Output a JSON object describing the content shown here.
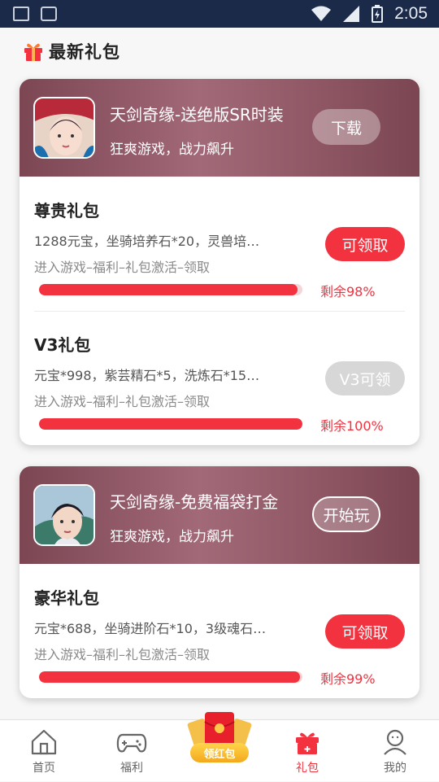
{
  "status_bar": {
    "time": "2:05"
  },
  "page": {
    "title": "最新礼包"
  },
  "cards": [
    {
      "game_title": "天剑奇缘-送绝版SR时装",
      "game_subtitle": "狂爽游戏，战力飙升",
      "head_button": "下载",
      "packs": [
        {
          "name": "尊贵礼包",
          "content": "1288元宝，坐骑培养石*20，灵兽培…",
          "how": "进入游戏–福利–礼包激活–领取",
          "button": "可领取",
          "remain": "剩余98%",
          "remain_fraction": 0.98
        },
        {
          "name": "V3礼包",
          "content": "元宝*998，紫芸精石*5，洗炼石*15…",
          "how": "进入游戏–福利–礼包激活–领取",
          "button": "V3可领",
          "remain": "剩余100%",
          "remain_fraction": 1.0
        }
      ]
    },
    {
      "game_title": "天剑奇缘-免费福袋打金",
      "game_subtitle": "狂爽游戏，战力飙升",
      "head_button": "开始玩",
      "packs": [
        {
          "name": "豪华礼包",
          "content": "元宝*688，坐骑进阶石*10，3级魂石…",
          "how": "进入游戏–福利–礼包激活–领取",
          "button": "可领取",
          "remain": "剩余99%",
          "remain_fraction": 0.99
        }
      ]
    }
  ],
  "tabbar": {
    "items": [
      {
        "label": "首页",
        "icon": "home-icon"
      },
      {
        "label": "福利",
        "icon": "gamepad-icon"
      },
      {
        "label": "领红包",
        "icon": "red-envelope-icon"
      },
      {
        "label": "礼包",
        "icon": "gift-icon"
      },
      {
        "label": "我的",
        "icon": "user-icon"
      }
    ],
    "active": "礼包"
  },
  "colors": {
    "accent": "#f2323f",
    "status_bar": "#1c2a4a",
    "card_header": "#8f5764"
  }
}
